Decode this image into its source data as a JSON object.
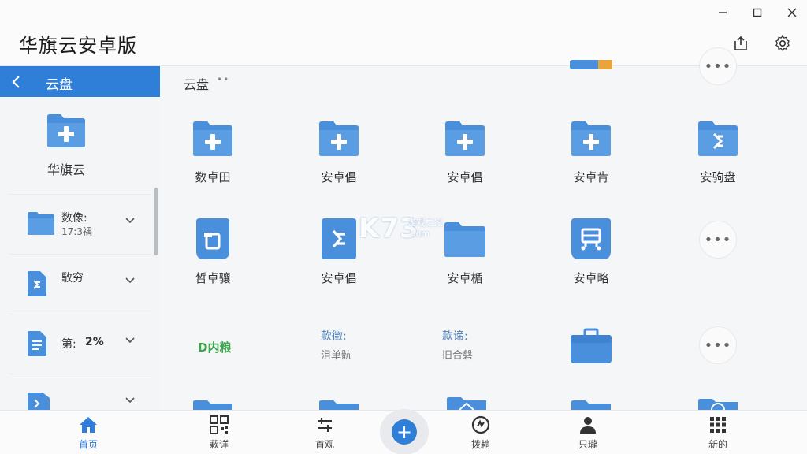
{
  "app": {
    "title": "华旗云安卓版"
  },
  "nav": {
    "back_label": "云盘"
  },
  "breadcrumb": {
    "current": "云盘",
    "dots": "••"
  },
  "sidebar": {
    "featured": {
      "label": "华旗云"
    },
    "rows": [
      {
        "title": "数像:",
        "subtitle": "17:3禑"
      },
      {
        "title": "駇穷",
        "subtitle": ""
      },
      {
        "title": "第:",
        "badge": "2%"
      },
      {
        "title": "",
        "subtitle": ""
      }
    ]
  },
  "grid": {
    "row1": [
      "数卓田",
      "安卓倡",
      "安卓倡",
      "安卓肯",
      "安驹盘"
    ],
    "row2": [
      "晳卓骧",
      "安卓倡",
      "安卓楯",
      "安卓略"
    ],
    "row3": {
      "green_label": "D内粮",
      "text1": {
        "a": "款徵:",
        "b": "沮单骯"
      },
      "text2": {
        "a": "款谛:",
        "b": "旧合磐"
      }
    },
    "more_label": "•••"
  },
  "watermark": {
    "main": "K73",
    "sub1": "游戏之家",
    "sub2": ".com"
  },
  "bottom_nav": [
    {
      "label": "首页",
      "icon": "home-icon",
      "active": true
    },
    {
      "label": "蔌详",
      "icon": "qr-grid-icon",
      "active": false
    },
    {
      "label": "首观",
      "icon": "sliders-icon",
      "active": false
    },
    {
      "label": "拨耥",
      "icon": "sync-icon",
      "active": false
    },
    {
      "label": "只瓏",
      "icon": "user-icon",
      "active": false
    },
    {
      "label": "新的",
      "icon": "apps-grid-icon",
      "active": false
    }
  ],
  "fab": {
    "label": "+"
  },
  "colors": {
    "accent": "#2f7fd8",
    "folder": "#4a8fdb",
    "badge_green": "#3fa34d"
  }
}
